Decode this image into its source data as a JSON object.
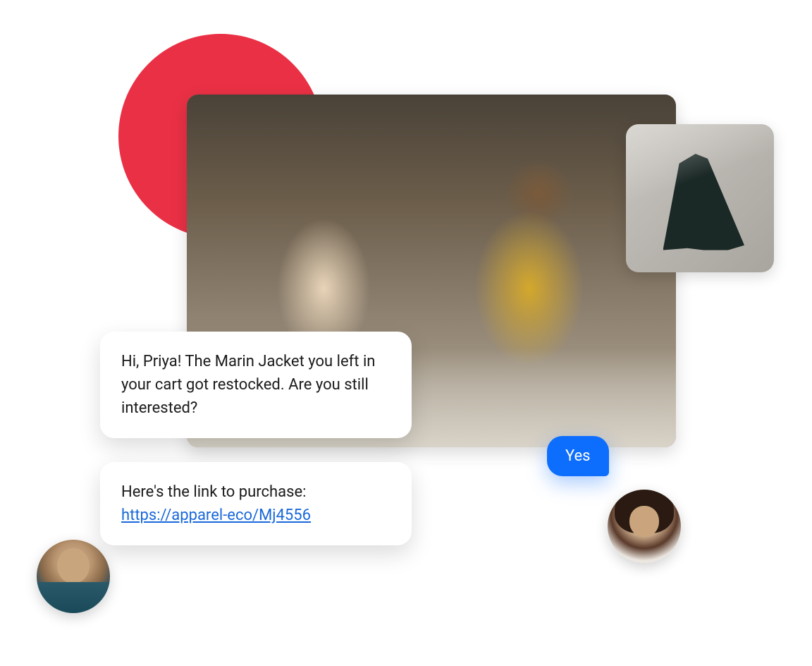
{
  "colors": {
    "accent_red": "#ea3045",
    "accent_blue": "#0d6efd",
    "link": "#1868db",
    "text": "#1a1a1a",
    "white": "#ffffff"
  },
  "messages": {
    "bubble1": "Hi, Priya! The Marin Jacket you left in your cart got restocked. Are you still interested?",
    "bubble2_text": "Here's the link to purchase: ",
    "bubble2_link": "https://apparel-eco/Mj4556",
    "reply": "Yes"
  },
  "avatars": {
    "left": "agent-avatar",
    "right": "customer-avatar"
  },
  "images": {
    "main": "retail-store-checkout-photo",
    "small": "shopping-bags-photo"
  }
}
